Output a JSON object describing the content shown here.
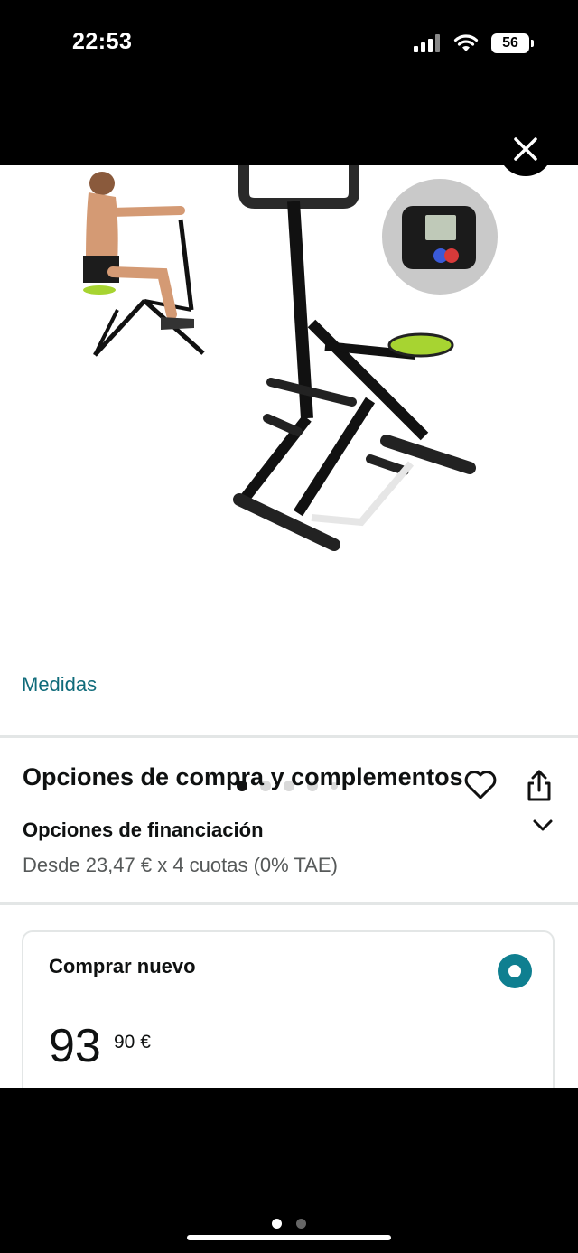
{
  "status_bar": {
    "time": "22:53",
    "battery": "56",
    "signal_icon": "cellular-signal-icon",
    "wifi_icon": "wifi-icon"
  },
  "carousel": {
    "dot_count": 5,
    "active_index": 0
  },
  "links": {
    "measurements": "Medidas"
  },
  "purchase": {
    "section_title": "Opciones de compra y complementos",
    "financing_title": "Opciones de financiación",
    "financing_text": "Desde 23,47 € x 4 cuotas (0% TAE)"
  },
  "buy_new": {
    "label": "Comprar nuevo",
    "price_whole": "93",
    "price_fraction": "90 €"
  },
  "colors": {
    "link": "#0f6b7a",
    "radio": "#0f7f90",
    "accent_green": "#a7d431"
  }
}
